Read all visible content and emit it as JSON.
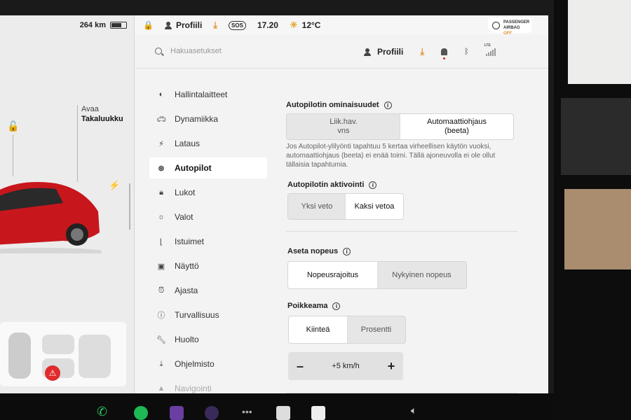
{
  "car": {
    "range": "264 km",
    "trunk_action": "Avaa",
    "trunk_name": "Takaluukku"
  },
  "statusbar": {
    "profile": "Profiili",
    "sos": "SOS",
    "time": "17.20",
    "temperature": "12°C",
    "airbag_line1": "PASSENGER",
    "airbag_line2": "AIRBAG",
    "airbag_status": "OFF"
  },
  "header": {
    "search_placeholder": "Hakuasetukset",
    "profile": "Profiili",
    "lte": "LTE"
  },
  "menu": {
    "items": [
      {
        "label": "Hallintalaitteet",
        "icon": "toggle-icon",
        "active": false
      },
      {
        "label": "Dynamiikka",
        "icon": "car-icon",
        "active": false
      },
      {
        "label": "Lataus",
        "icon": "bolt-icon",
        "active": false
      },
      {
        "label": "Autopilot",
        "icon": "steering-wheel-icon",
        "active": true
      },
      {
        "label": "Lukot",
        "icon": "lock-icon",
        "active": false
      },
      {
        "label": "Valot",
        "icon": "light-icon",
        "active": false
      },
      {
        "label": "Istuimet",
        "icon": "seat-icon",
        "active": false
      },
      {
        "label": "Näyttö",
        "icon": "display-icon",
        "active": false
      },
      {
        "label": "Ajasta",
        "icon": "alarm-clock-icon",
        "active": false
      },
      {
        "label": "Turvallisuus",
        "icon": "safety-icon",
        "active": false
      },
      {
        "label": "Huolto",
        "icon": "wrench-icon",
        "active": false
      },
      {
        "label": "Ohjelmisto",
        "icon": "download-icon",
        "active": false
      },
      {
        "label": "Navigointi",
        "icon": "navigation-icon",
        "active": false
      }
    ]
  },
  "autopilot_features": {
    "title": "Autopilotin ominaisuudet",
    "option1_line1": "Liik.hav.",
    "option1_line2": "vns",
    "option2_line1": "Automaattiohjaus",
    "option2_line2": "(beeta)",
    "selected": 2,
    "description": "Jos Autopilot-ylilyönti tapahtuu 5 kertaa virheellisen käytön vuoksi, automaattiohjaus (beeta) ei enää toimi. Tällä ajoneuvolla ei ole ollut tällaisia tapahtumia."
  },
  "autopilot_activation": {
    "title": "Autopilotin aktivointi",
    "option1": "Yksi veto",
    "option2": "Kaksi vetoa",
    "selected": 2
  },
  "set_speed": {
    "title": "Aseta nopeus",
    "option1": "Nopeusrajoitus",
    "option2": "Nykyinen nopeus",
    "selected": 1
  },
  "offset": {
    "title": "Poikkeama",
    "option1": "Kiinteä",
    "option2": "Prosentti",
    "selected": 1,
    "minus": "–",
    "value": "+5 km/h",
    "plus": "+"
  },
  "dock": {
    "more": "•••"
  },
  "colors": {
    "accent_orange": "#e0922e",
    "alert_red": "#e12b2b",
    "spotify_green": "#1db954"
  }
}
